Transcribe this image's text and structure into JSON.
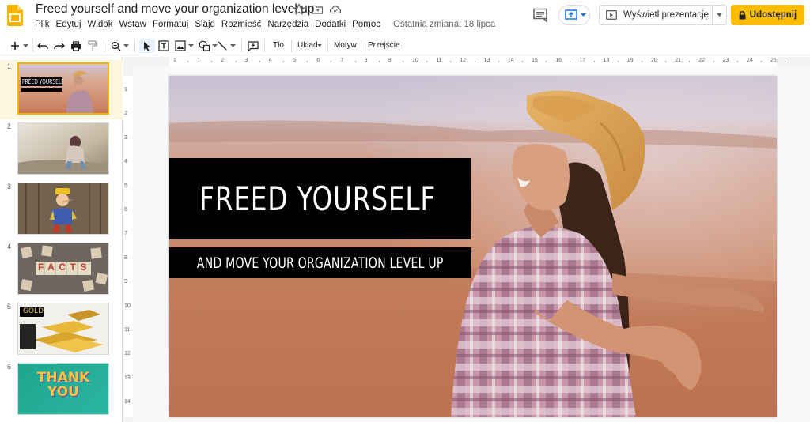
{
  "app": {
    "doc_title": "Freed yourself and move your organization level up",
    "last_edit": "Ostatnia zmiana: 18 lipca",
    "menu": [
      "Plik",
      "Edytuj",
      "Widok",
      "Wstaw",
      "Formatuj",
      "Slajd",
      "Rozmieść",
      "Narzędzia",
      "Dodatki",
      "Pomoc"
    ],
    "present_label": "Wyświetl prezentację",
    "share_label": "Udostępnij",
    "accent_color": "#fbbc04"
  },
  "toolbar": {
    "background_label": "Tło",
    "layout_label": "Układ",
    "theme_label": "Motyw",
    "transition_label": "Przejście"
  },
  "ruler": {
    "h_labels": [
      "1",
      "1",
      "2",
      "3",
      "4",
      "5",
      "6",
      "7",
      "8",
      "9",
      "10",
      "11",
      "12",
      "13",
      "14",
      "15",
      "16",
      "17",
      "18",
      "19",
      "20",
      "21",
      "22",
      "23",
      "24",
      "25"
    ],
    "v_labels": [
      "1",
      "2",
      "3",
      "4",
      "5",
      "6",
      "7",
      "8",
      "9",
      "10",
      "11",
      "12",
      "13",
      "14"
    ]
  },
  "filmstrip": {
    "slides": [
      {
        "number": "1",
        "caption": "FREED YOURSELF",
        "selected": true
      },
      {
        "number": "2"
      },
      {
        "number": "3"
      },
      {
        "number": "4",
        "caption": "FACTS"
      },
      {
        "number": "5",
        "caption": "GOLD"
      },
      {
        "number": "6",
        "caption": "THANK YOU"
      }
    ]
  },
  "slide": {
    "title": "FREED YOURSELF",
    "subtitle": "AND MOVE YOUR ORGANIZATION LEVEL UP"
  }
}
